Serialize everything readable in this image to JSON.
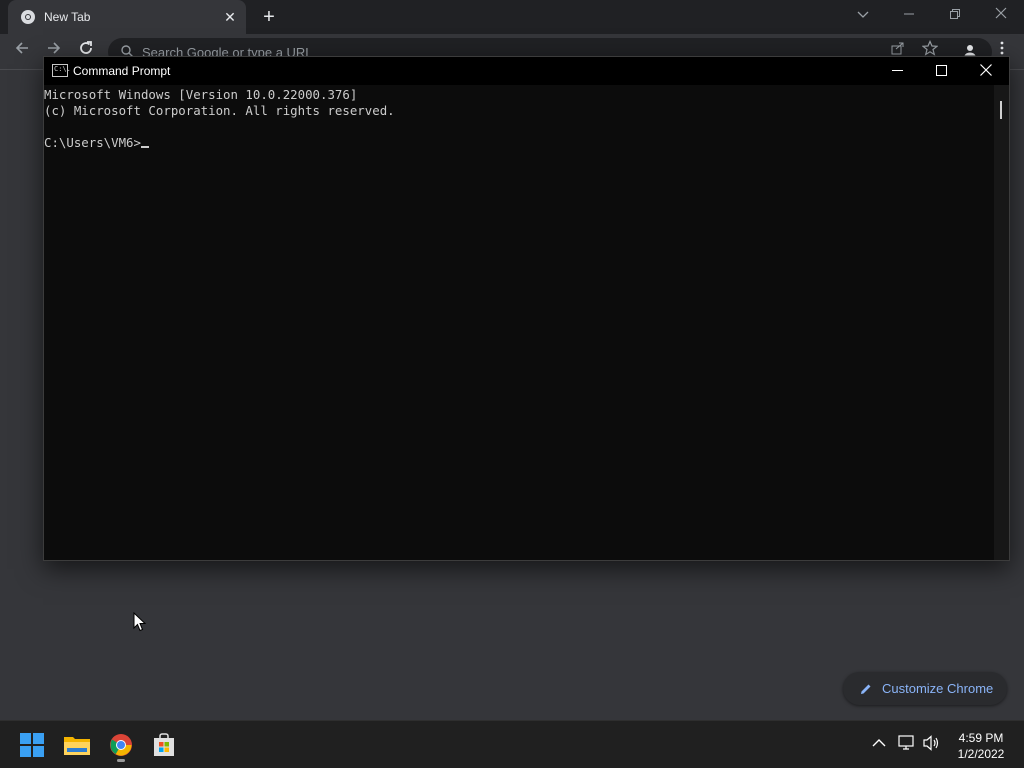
{
  "chrome": {
    "tab_title": "New Tab",
    "tab_close": "✕",
    "new_tab": "+",
    "omnibox_placeholder": "Search Google or type a URL",
    "customize_label": "Customize Chrome",
    "accent_color": "#8ab4f8"
  },
  "cmd": {
    "title": "Command Prompt",
    "icon_text": "C:\\.",
    "minimize": "—",
    "maximize": "☐",
    "close": "✕",
    "lines": [
      "Microsoft Windows [Version 10.0.22000.376]",
      "(c) Microsoft Corporation. All rights reserved.",
      "",
      "C:\\Users\\VM6>"
    ]
  },
  "taskbar": {
    "apps": [
      "start-icon",
      "file-explorer-icon",
      "chrome-icon",
      "microsoft-store-icon"
    ],
    "time": "4:59 PM",
    "date": "1/2/2022"
  }
}
